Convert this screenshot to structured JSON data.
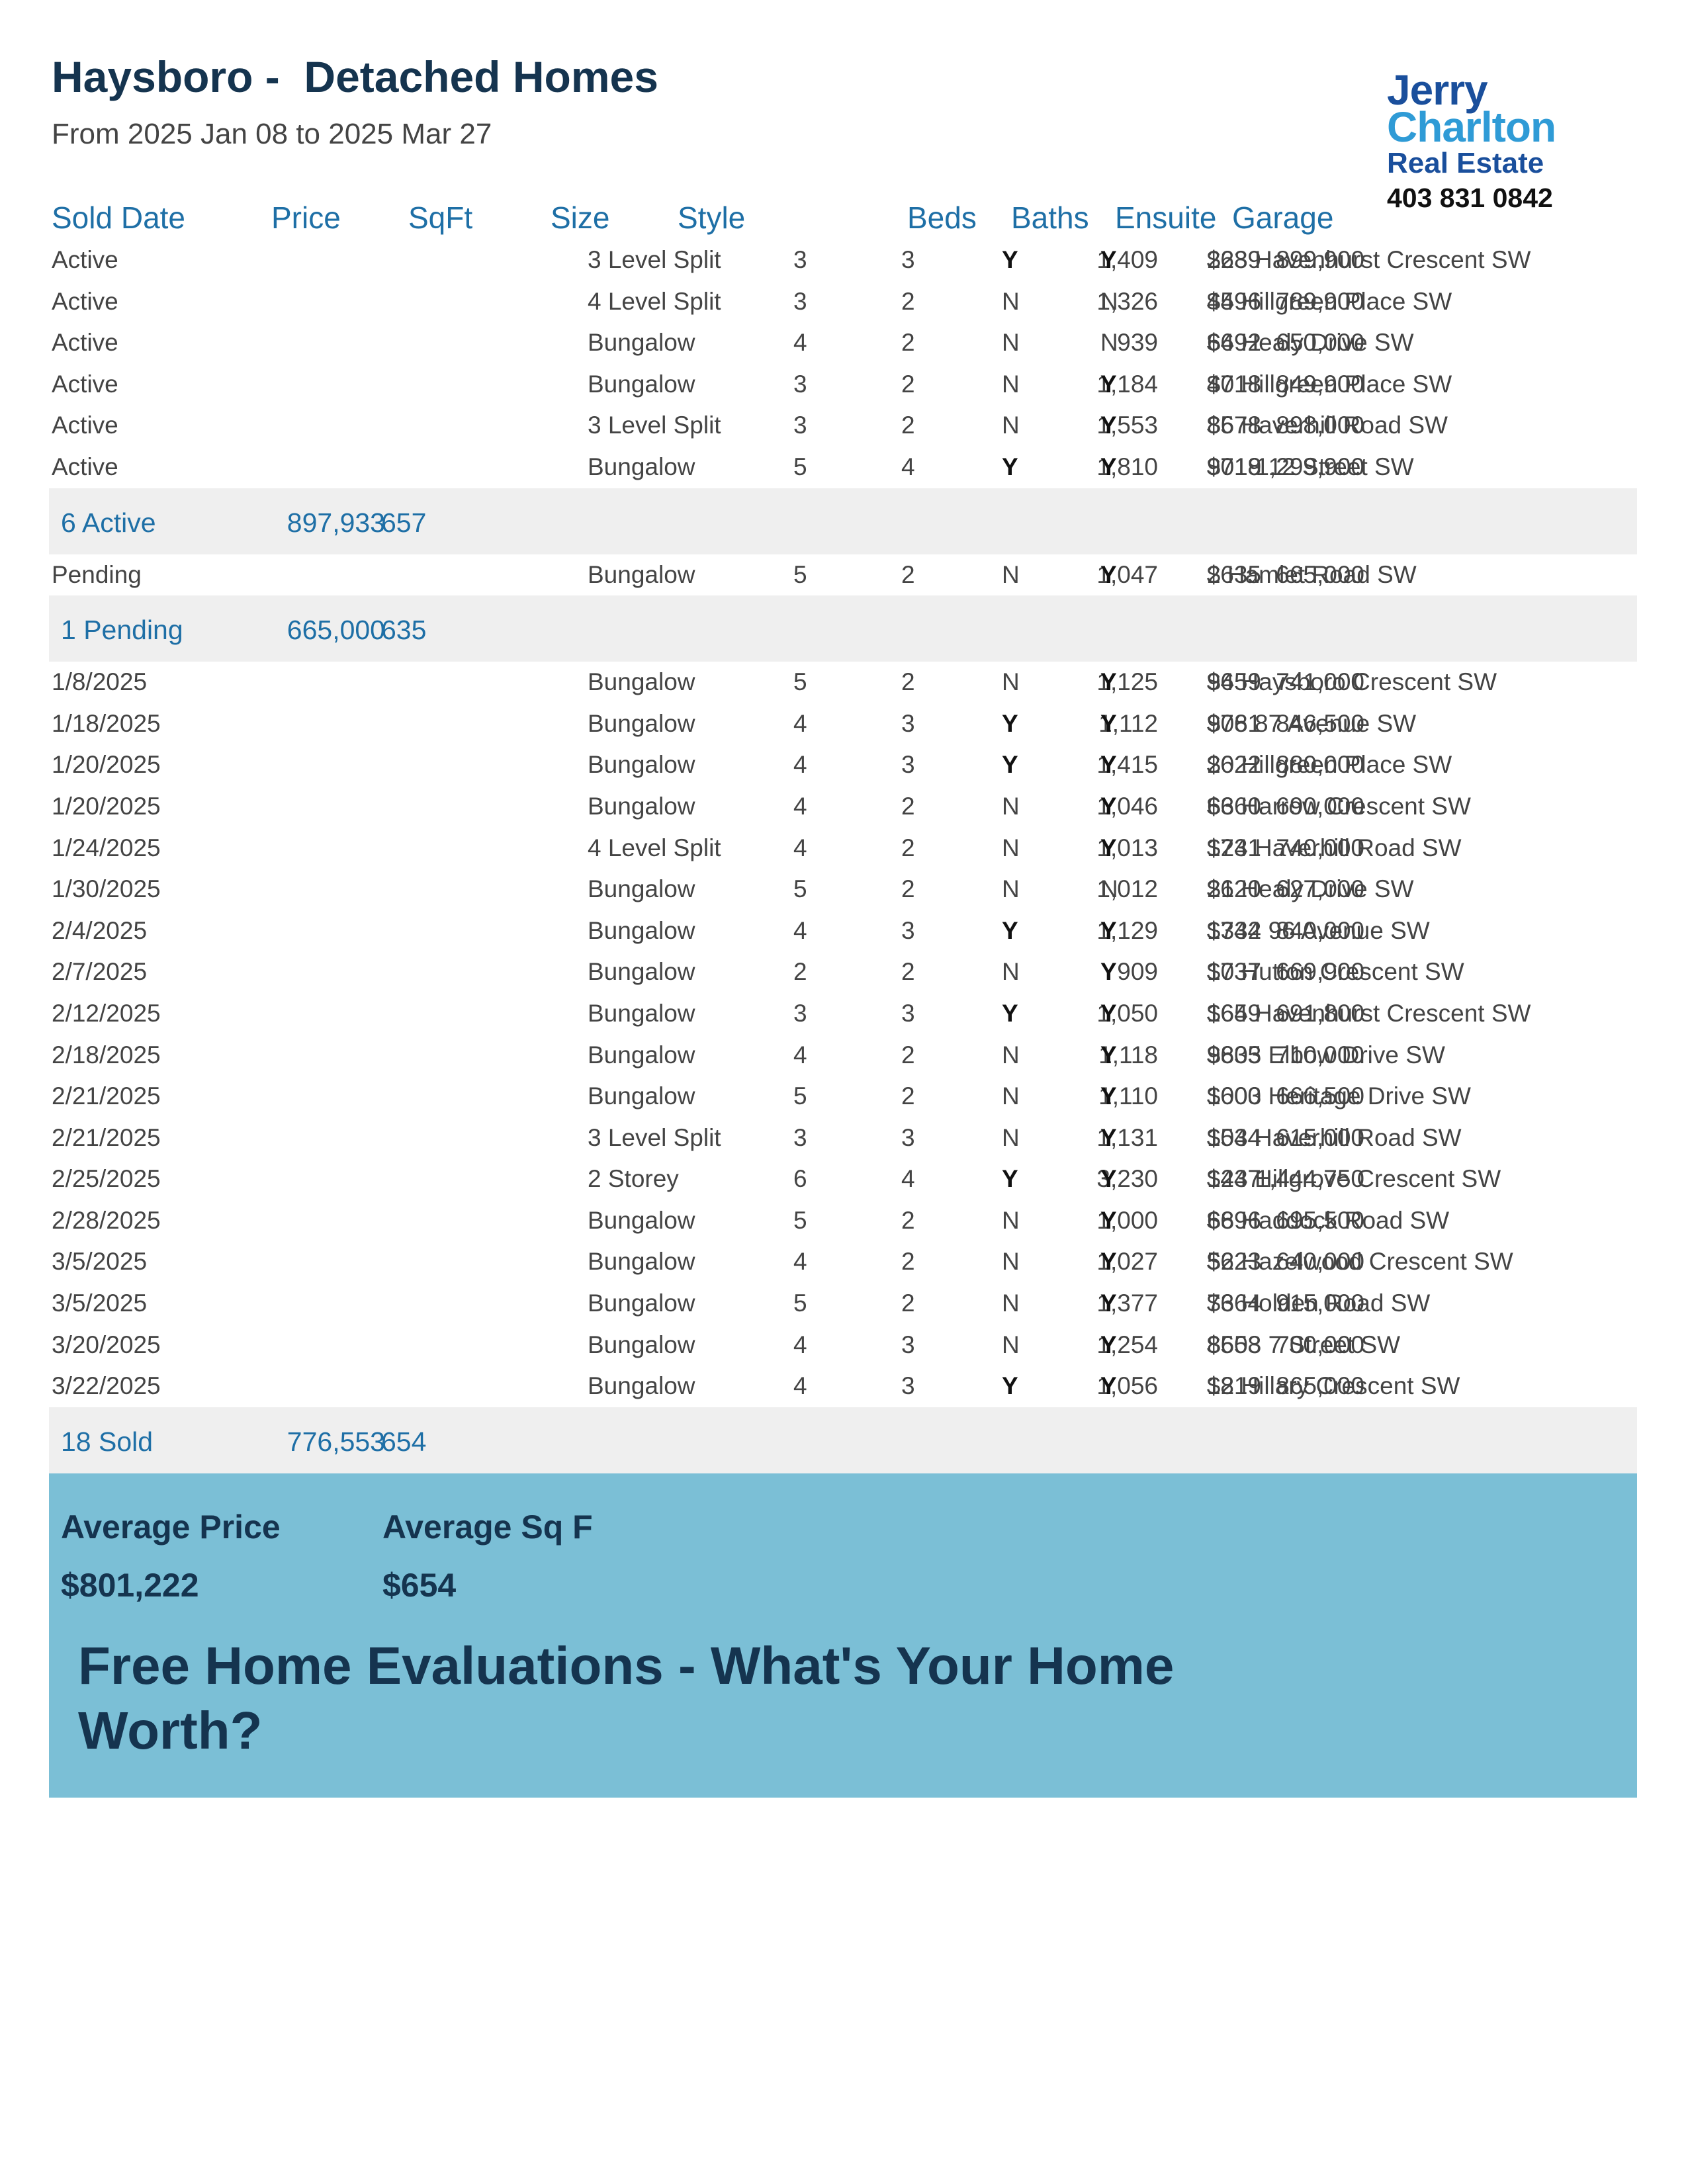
{
  "header": {
    "title": "Haysboro -  Detached Homes",
    "date_range": "From 2025 Jan 08 to 2025 Mar 27"
  },
  "logo": {
    "line1": "Jerry",
    "line2": "Charlton",
    "line3": "Real Estate",
    "phone": "403 831 0842",
    "colors": {
      "dark": "#1a4f9c",
      "light": "#2f9bd6"
    }
  },
  "columns": [
    "Sold Date",
    "Price",
    "SqFt",
    "Size",
    "Style",
    "Beds",
    "Baths",
    "Ensuite",
    "Garage"
  ],
  "active": {
    "rows": [
      [
        "Active",
        "899,900",
        "$639",
        "1,409",
        "3 Level Split",
        "3",
        "3",
        "Y",
        "Y",
        "228 Havenhurst Crescent SW"
      ],
      [
        "Active",
        "789,900",
        "$596",
        "1,326",
        "4 Level Split",
        "3",
        "2",
        "N",
        "N",
        "44 Hillgreen Place SW"
      ],
      [
        "Active",
        "650,000",
        "$692",
        "939",
        "Bungalow",
        "4",
        "2",
        "N",
        "N",
        "64 Healy Drive SW"
      ],
      [
        "Active",
        "849,900",
        "$718",
        "1,184",
        "Bungalow",
        "3",
        "2",
        "N",
        "Y",
        "40 Hillgreen Place SW"
      ],
      [
        "Active",
        "898,000",
        "$578",
        "1,553",
        "3 Level Split",
        "3",
        "2",
        "N",
        "Y",
        "86 Haverhill Road SW"
      ],
      [
        "Active",
        "1,299,900",
        "$718",
        "1,810",
        "Bungalow",
        "5",
        "4",
        "Y",
        "Y",
        "9019 12 Street SW"
      ]
    ],
    "summary": {
      "label": "6 Active",
      "price": "897,933",
      "sqft": "657"
    }
  },
  "pending": {
    "rows": [
      [
        "Pending",
        "665,000",
        "$635",
        "1,047",
        "Bungalow",
        "5",
        "2",
        "N",
        "Y",
        "2 Hamlet Road SW"
      ]
    ],
    "summary": {
      "label": "1 Pending",
      "price": "665,000",
      "sqft": "635"
    }
  },
  "sold": {
    "rows": [
      [
        "1/8/2025",
        "741,000",
        "$659",
        "1,125",
        "Bungalow",
        "5",
        "2",
        "N",
        "Y",
        "94 Haysboro Crescent SW"
      ],
      [
        "1/18/2025",
        "846,500",
        "$761",
        "1,112",
        "Bungalow",
        "4",
        "3",
        "Y",
        "Y",
        "908 87 Avenue SW"
      ],
      [
        "1/20/2025",
        "880,000",
        "$622",
        "1,415",
        "Bungalow",
        "4",
        "3",
        "Y",
        "Y",
        "20 Hillgreen Place SW"
      ],
      [
        "1/20/2025",
        "690,000",
        "$660",
        "1,046",
        "Bungalow",
        "4",
        "2",
        "N",
        "Y",
        "63 Harrow Crescent SW"
      ],
      [
        "1/24/2025",
        "740,000",
        "$731",
        "1,013",
        "4 Level Split",
        "4",
        "2",
        "N",
        "Y",
        "124 Haverhill Road SW"
      ],
      [
        "1/30/2025",
        "627,000",
        "$620",
        "1,012",
        "Bungalow",
        "5",
        "2",
        "N",
        "N",
        "21 Healy Drive SW"
      ],
      [
        "2/4/2025",
        "840,000",
        "$744",
        "1,129",
        "Bungalow",
        "4",
        "3",
        "Y",
        "Y",
        "1332 96 Avenue SW"
      ],
      [
        "2/7/2025",
        "669,900",
        "$737",
        "909",
        "Bungalow",
        "2",
        "2",
        "N",
        "Y",
        "10 Hutton Crescent SW"
      ],
      [
        "2/12/2025",
        "691,800",
        "$659",
        "1,050",
        "Bungalow",
        "3",
        "3",
        "Y",
        "Y",
        "164 Havenhurst Crescent SW"
      ],
      [
        "2/18/2025",
        "710,000",
        "$635",
        "1,118",
        "Bungalow",
        "4",
        "2",
        "N",
        "Y",
        "9803 Elbow Drive SW"
      ],
      [
        "2/21/2025",
        "666,500",
        "$600",
        "1,110",
        "Bungalow",
        "5",
        "2",
        "N",
        "Y",
        "1003 Heritage Drive SW"
      ],
      [
        "2/21/2025",
        "615,000",
        "$544",
        "1,131",
        "3 Level Split",
        "3",
        "3",
        "N",
        "Y",
        "103 Haverhill Road SW"
      ],
      [
        "2/25/2025",
        "1,444,750",
        "$447",
        "3,230",
        "2 Storey",
        "6",
        "4",
        "Y",
        "Y",
        "123 Hillgrove Crescent SW"
      ],
      [
        "2/28/2025",
        "695,500",
        "$696",
        "1,000",
        "Bungalow",
        "5",
        "2",
        "N",
        "Y",
        "68 Haddock Road SW"
      ],
      [
        "3/5/2025",
        "640,000",
        "$623",
        "1,027",
        "Bungalow",
        "4",
        "2",
        "N",
        "Y",
        "52 Hazelwood Crescent SW"
      ],
      [
        "3/5/2025",
        "915,000",
        "$664",
        "1,377",
        "Bungalow",
        "5",
        "2",
        "N",
        "Y",
        "73 Holden Road SW"
      ],
      [
        "3/20/2025",
        "700,000",
        "$558",
        "1,254",
        "Bungalow",
        "4",
        "3",
        "N",
        "Y",
        "8603 7 Street SW"
      ],
      [
        "3/22/2025",
        "865,000",
        "$819",
        "1,056",
        "Bungalow",
        "4",
        "3",
        "Y",
        "Y",
        "12 Hillary Crescent SW"
      ]
    ],
    "summary": {
      "label": "18 Sold",
      "price": "776,553",
      "sqft": "654"
    }
  },
  "averages": {
    "price_label": "Average Price",
    "price_value": "$801,222",
    "sqft_label": "Average Sq F",
    "sqft_value": "$654"
  },
  "promo": "Free Home Evaluations - What's Your Home Worth?",
  "colors": {
    "heading": "#15344f",
    "accent": "#1e6fa6",
    "band": "#7bbfd6",
    "summary_bg": "#efefef"
  }
}
